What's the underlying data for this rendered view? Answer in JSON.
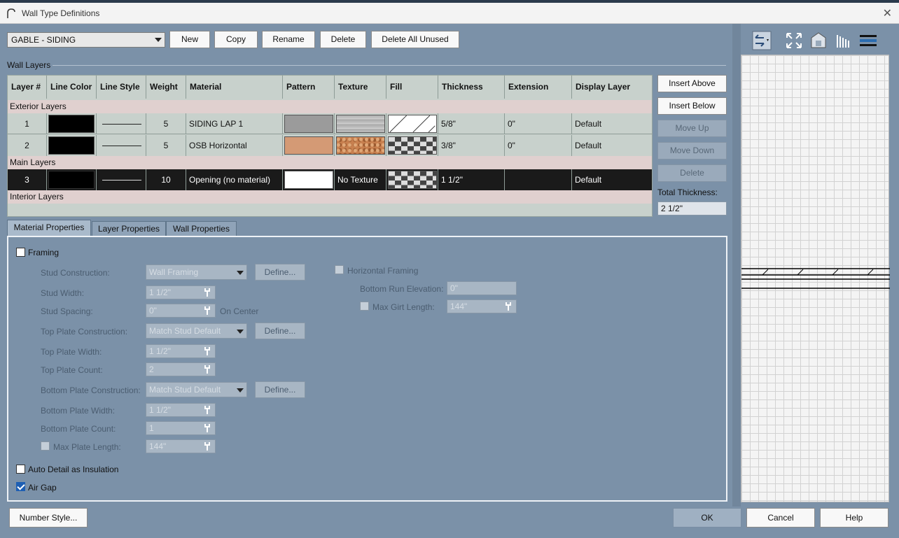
{
  "window": {
    "title": "Wall Type Definitions"
  },
  "top": {
    "wall_type_select": "GABLE - SIDING",
    "buttons": {
      "new": "New",
      "copy": "Copy",
      "rename": "Rename",
      "delete": "Delete",
      "delete_all_unused": "Delete All Unused"
    }
  },
  "wall_layers": {
    "section_label": "Wall Layers",
    "headers": [
      "Layer #",
      "Line Color",
      "Line Style",
      "Weight",
      "Material",
      "Pattern",
      "Texture",
      "Fill",
      "Thickness",
      "Extension",
      "Display Layer"
    ],
    "groups": {
      "exterior": "Exterior Layers",
      "main": "Main Layers",
      "interior": "Interior Layers"
    },
    "rows": [
      {
        "num": "1",
        "weight": "5",
        "material": "SIDING LAP 1",
        "texture": "",
        "thickness": "5/8\"",
        "extension": "0\"",
        "display_layer": "Default"
      },
      {
        "num": "2",
        "weight": "5",
        "material": "OSB Horizontal",
        "texture": "",
        "thickness": "3/8\"",
        "extension": "0\"",
        "display_layer": "Default"
      },
      {
        "num": "3",
        "weight": "10",
        "material": "Opening (no material)",
        "texture": "No Texture",
        "thickness": "1 1/2\"",
        "extension": "",
        "display_layer": "Default"
      }
    ],
    "side_buttons": {
      "insert_above": "Insert Above",
      "insert_below": "Insert Below",
      "move_up": "Move Up",
      "move_down": "Move Down",
      "delete": "Delete"
    },
    "total_thickness_label": "Total Thickness:",
    "total_thickness": "2 1/2\""
  },
  "tabs": [
    "Material Properties",
    "Layer Properties",
    "Wall Properties"
  ],
  "material_properties": {
    "framing": "Framing",
    "stud_construction": {
      "label": "Stud Construction:",
      "value": "Wall Framing",
      "define": "Define..."
    },
    "stud_width": {
      "label": "Stud Width:",
      "value": "1 1/2\""
    },
    "stud_spacing": {
      "label": "Stud Spacing:",
      "value": "0\"",
      "suffix": "On Center"
    },
    "top_plate_construction": {
      "label": "Top Plate Construction:",
      "value": "Match Stud Default",
      "define": "Define..."
    },
    "top_plate_width": {
      "label": "Top Plate Width:",
      "value": "1 1/2\""
    },
    "top_plate_count": {
      "label": "Top Plate Count:",
      "value": "2"
    },
    "bottom_plate_construction": {
      "label": "Bottom Plate Construction:",
      "value": "Match Stud Default",
      "define": "Define..."
    },
    "bottom_plate_width": {
      "label": "Bottom Plate Width:",
      "value": "1 1/2\""
    },
    "bottom_plate_count": {
      "label": "Bottom Plate Count:",
      "value": "1"
    },
    "max_plate_length": {
      "label": "Max Plate Length:",
      "value": "144\""
    },
    "horizontal_framing": "Horizontal Framing",
    "bottom_run_elevation": {
      "label": "Bottom Run Elevation:",
      "value": "0\""
    },
    "max_girt_length": {
      "label": "Max Girt Length:",
      "value": "144\""
    },
    "auto_detail": "Auto Detail as Insulation",
    "air_gap": "Air Gap"
  },
  "bottom_buttons": {
    "number_style": "Number Style...",
    "ok": "OK",
    "cancel": "Cancel",
    "help": "Help"
  },
  "colors": {
    "dialog_bg": "#7b91a8",
    "row_selected": "#1a1a1a",
    "group_bg": "#e0d0cf",
    "table_bg": "#c8d1cc",
    "checkbox_on": "#1e5fb3"
  }
}
